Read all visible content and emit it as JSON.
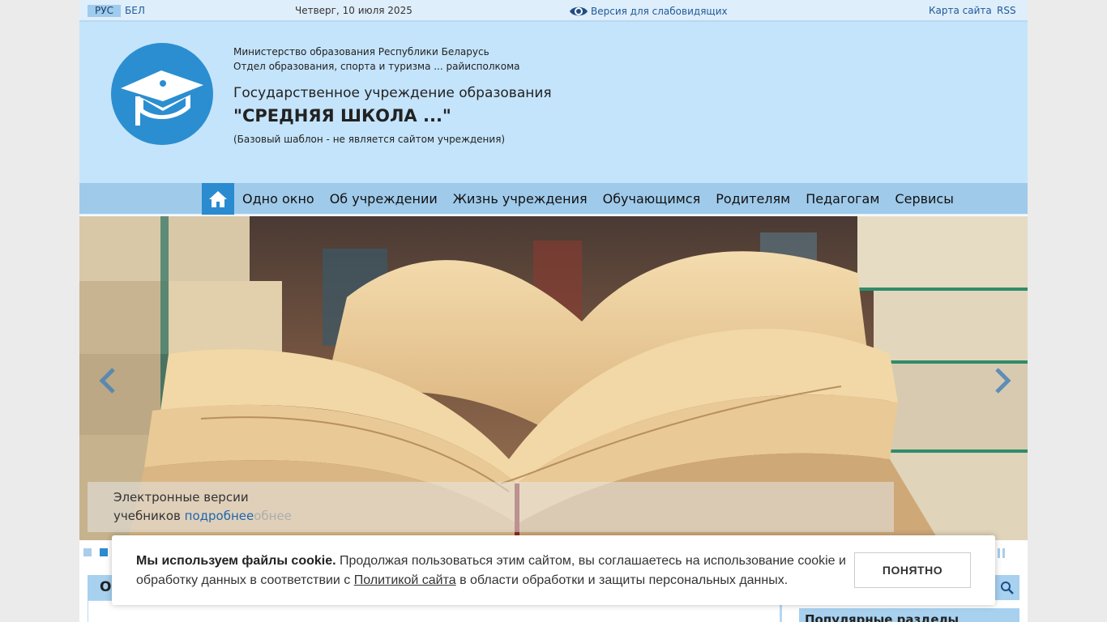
{
  "topbar": {
    "lang_ru": "РУС",
    "lang_be": "БЕЛ",
    "date": "Четверг, 10 июля 2025",
    "accessibility_link": "Версия для слабовидящих",
    "sitemap_link": "Карта сайта",
    "rss_link": "RSS"
  },
  "header": {
    "ministry": "Министерство образования Республики Беларусь",
    "department": "Отдел образования, спорта и туризма ... райисполкома",
    "institution_type": "Государственное учреждение образования",
    "school_name": "\"СРЕДНЯЯ ШКОЛА ...\"",
    "note": "(Базовый шаблон - не является сайтом учреждения)",
    "logo_icon": "graduation-cap-icon"
  },
  "nav": {
    "home_icon": "home-icon",
    "items": [
      {
        "label": "Одно окно"
      },
      {
        "label": "Об учреждении"
      },
      {
        "label": "Жизнь учреждения"
      },
      {
        "label": "Обучающимся"
      },
      {
        "label": "Родителям"
      },
      {
        "label": "Педагогам"
      },
      {
        "label": "Сервисы"
      }
    ]
  },
  "slider": {
    "caption_line1": "Электронные версии",
    "caption_line2": "учебников",
    "caption_more": "подробнее",
    "caption_ghost": "обнее",
    "active_slide": 2,
    "slide_count": 2
  },
  "content": {
    "tab_label": "О",
    "popular_label": "Популярные разделы"
  },
  "cookie": {
    "bold": "Мы используем файлы cookie.",
    "text1": " Продолжая пользоваться этим сайтом, вы соглашаетесь на использование cookie и обработку данных в соответствии с ",
    "policy_link": "Политикой сайта",
    "text2": " в области обработки и защиты персональных данных.",
    "button": "ПОНЯТНО"
  },
  "colors": {
    "accent": "#2a8bd0",
    "header_bg": "#c4e4fb",
    "nav_bg": "#9fcaea",
    "link": "#1d5a9a"
  }
}
